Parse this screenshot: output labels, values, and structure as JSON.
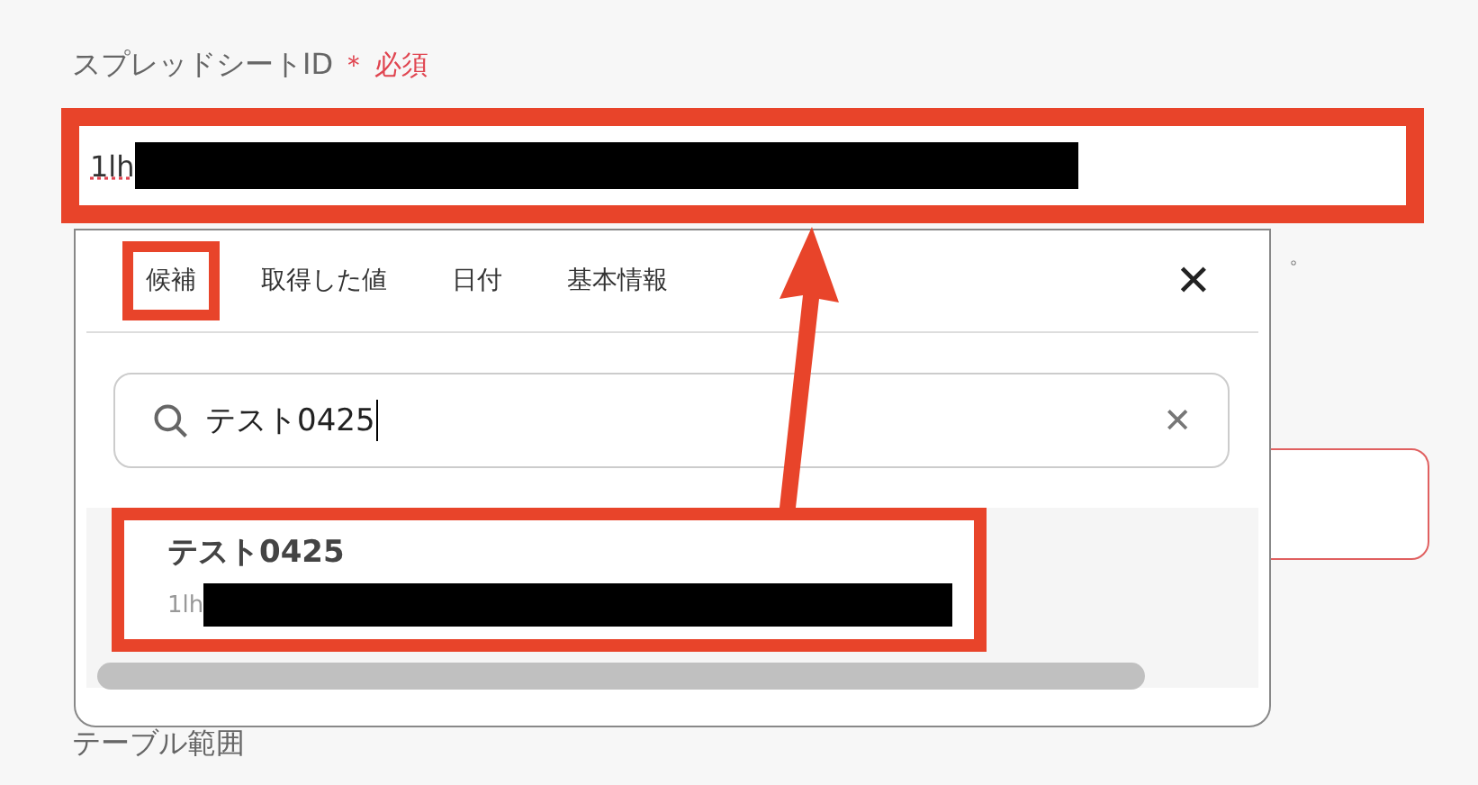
{
  "field": {
    "label": "スプレッドシートID",
    "required_mark": "＊",
    "required": "必須",
    "value": "1lh",
    "redacted": true,
    "highlighted": true
  },
  "hint_fragment": "。",
  "popup": {
    "tabs": [
      {
        "label": "候補",
        "selected": true
      },
      {
        "label": "取得した値",
        "selected": false
      },
      {
        "label": "日付",
        "selected": false
      },
      {
        "label": "基本情報",
        "selected": false
      }
    ],
    "close": "✕",
    "search": {
      "value": "テスト0425",
      "clear": "✕"
    },
    "results": [
      {
        "title": "テスト0425",
        "subtitle": "1lh",
        "redacted": true,
        "highlighted": true
      }
    ]
  },
  "next_field": {
    "label": "テーブル範囲"
  }
}
